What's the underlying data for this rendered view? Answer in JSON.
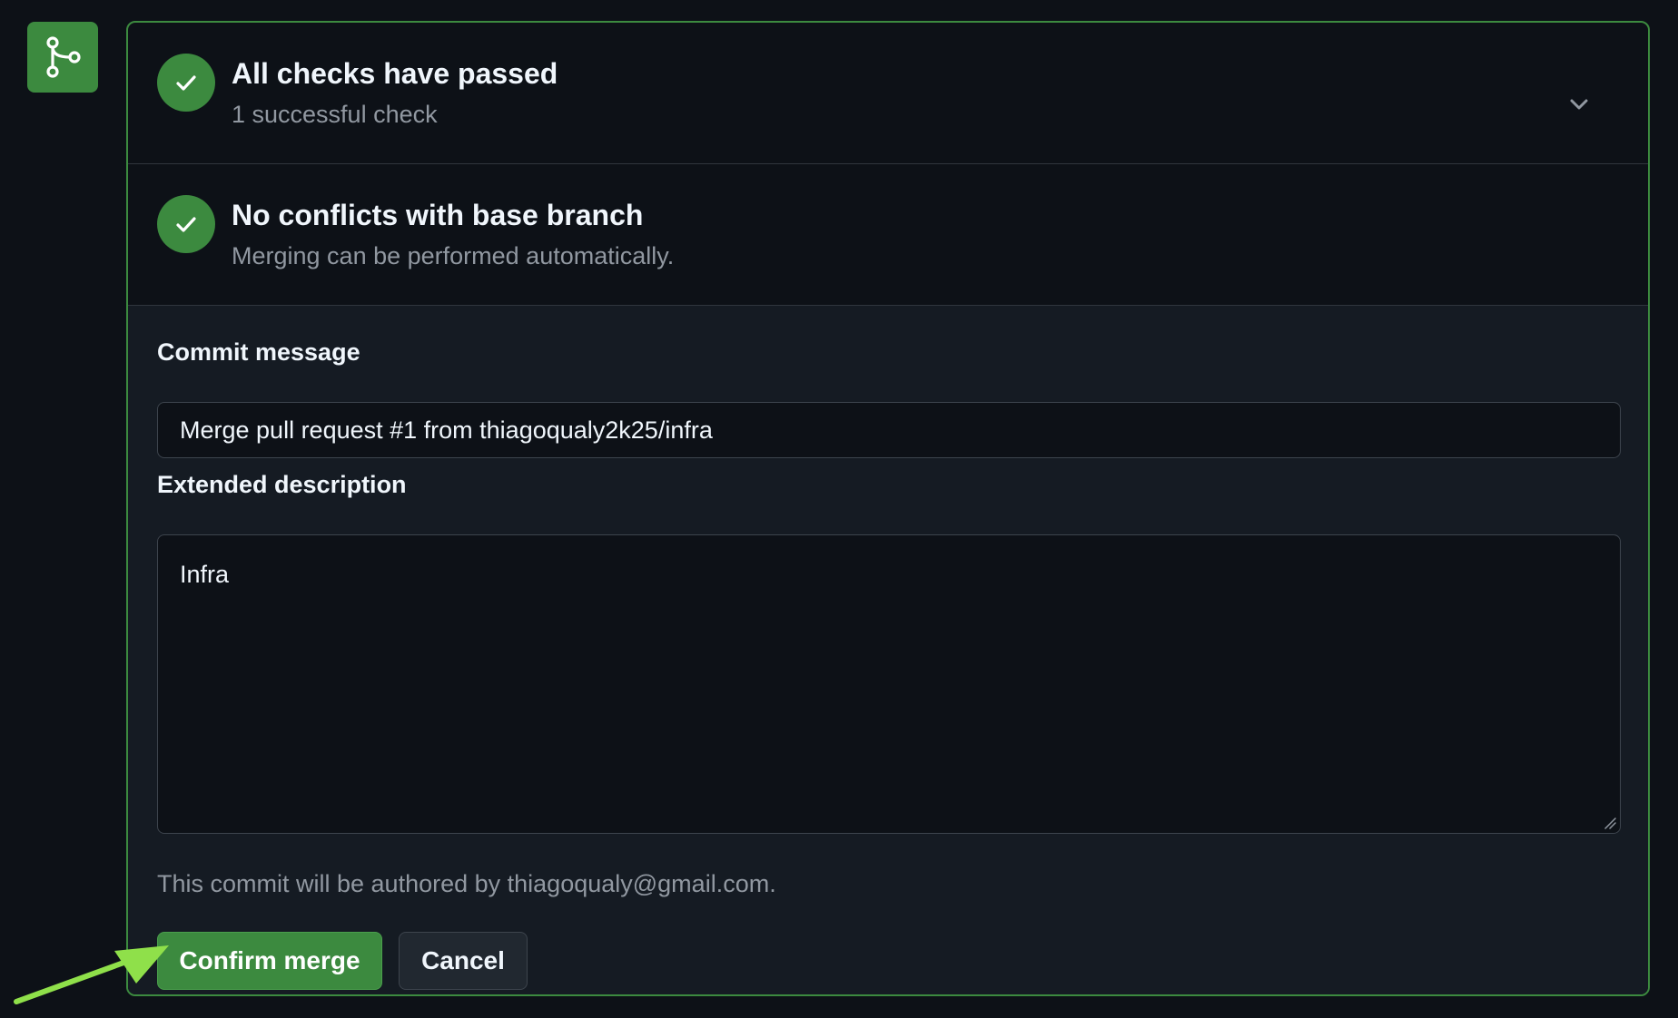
{
  "checks": {
    "title": "All checks have passed",
    "subtitle": "1 successful check"
  },
  "conflicts": {
    "title": "No conflicts with base branch",
    "subtitle": "Merging can be performed automatically."
  },
  "form": {
    "commit_label": "Commit message",
    "commit_value": "Merge pull request #1 from thiagoqualy2k25/infra",
    "description_label": "Extended description",
    "description_value": "Infra",
    "author_note": "This commit will be authored by thiagoqualy@gmail.com."
  },
  "buttons": {
    "confirm_label": "Confirm merge",
    "cancel_label": "Cancel"
  },
  "colors": {
    "accent_green": "#3c8a3f",
    "background": "#0d1117",
    "annotation_arrow": "#8fe04a"
  },
  "icons": {
    "merge": "git-merge-icon",
    "check": "check-icon",
    "chevron": "chevron-down-icon"
  }
}
